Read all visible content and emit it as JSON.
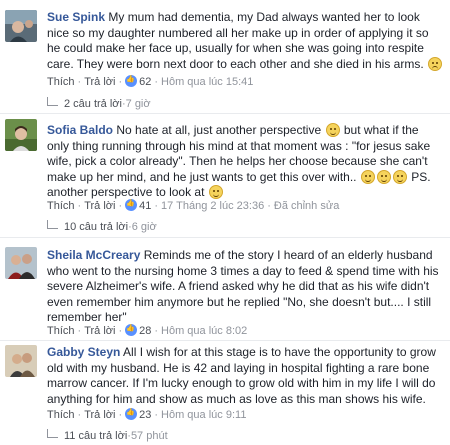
{
  "comments": [
    {
      "author": "Sue Spink",
      "text": "My mum had dementia, my Dad always wanted her to look nice so my daughter numbered all her make up in order of applying it so he could make her face up, usually for when she was going into respite care. They were born next door to each other and she died in his arms.",
      "like_label": "Thích",
      "reply_label": "Trả lời",
      "like_count": "62",
      "time": "Hôm qua lúc 15:41",
      "replies": "2 câu trả lời",
      "replies_time": "7 giờ"
    },
    {
      "author": "Sofia Baldo",
      "text_1": "No hate at all, just another perspective",
      "text_2": "but what if the only thing running through his mind at that moment was : \"for jesus sake wife, pick a color already\". Then he helps her choose because she can't make up her mind, and he just wants to get this over with..",
      "text_3": "PS. another perspective to look at",
      "like_label": "Thích",
      "reply_label": "Trả lời",
      "like_count": "41",
      "time": "17 Tháng 2 lúc 23:36",
      "edited": "Đã chỉnh sửa",
      "replies": "10 câu trả lời",
      "replies_time": "6 giờ"
    },
    {
      "author": "Sheila McCreary",
      "text": "Reminds me of the story I heard of an elderly husband who went to the nursing home 3 times a day to feed & spend time with his severe Alzheimer's wife. A friend asked why he did that as his wife didn't even remember him anymore but he replied \"No, she doesn't but.... I still remember her\"",
      "like_label": "Thích",
      "reply_label": "Trả lời",
      "like_count": "28",
      "time": "Hôm qua lúc 8:02"
    },
    {
      "author": "Gabby Steyn",
      "text": "All I wish for at this stage is to have the opportunity to grow old with my husband. He is 42 and laying in hospital fighting a rare bone marrow cancer. If I'm lucky enough to grow old with him in my life I will do anything for him and show as much as love as this man shows his wife.",
      "like_label": "Thích",
      "reply_label": "Trả lời",
      "like_count": "23",
      "time": "Hôm qua lúc 9:11",
      "replies": "11 câu trả lời",
      "replies_time": "57 phút"
    }
  ]
}
